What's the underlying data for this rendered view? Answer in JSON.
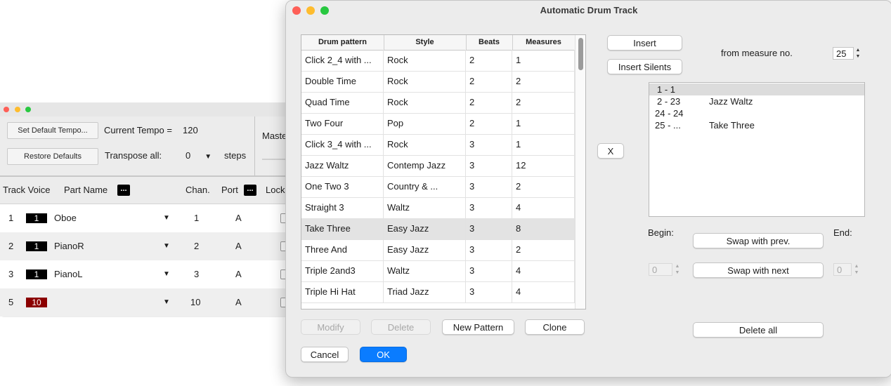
{
  "background_window": {
    "set_default_tempo_label": "Set Default Tempo...",
    "current_tempo_label": "Current Tempo =",
    "current_tempo_value": "120",
    "restore_defaults_label": "Restore Defaults",
    "transpose_label": "Transpose all:",
    "transpose_value": "0",
    "steps_label": "steps",
    "master_label": "Maste",
    "headers": {
      "track_voice": "Track Voice",
      "part_name": "Part Name",
      "ellipsis": "...",
      "chan": "Chan.",
      "port": "Port",
      "lock": "Lock"
    },
    "tracks": [
      {
        "num": "1",
        "voice": "1",
        "name": "Oboe",
        "chan": "1",
        "port": "A"
      },
      {
        "num": "2",
        "voice": "1",
        "name": "PianoR",
        "chan": "2",
        "port": "A"
      },
      {
        "num": "3",
        "voice": "1",
        "name": "PianoL",
        "chan": "3",
        "port": "A"
      },
      {
        "num": "5",
        "voice": "10",
        "name": "",
        "chan": "10",
        "port": "A"
      }
    ],
    "colors": {
      "voice_default": "#000000",
      "voice_drum": "#8b0000"
    }
  },
  "dialog": {
    "title": "Automatic Drum Track",
    "table_headers": {
      "pattern": "Drum pattern",
      "style": "Style",
      "beats": "Beats",
      "measures": "Measures"
    },
    "patterns": [
      {
        "pattern": "Click 2_4 with ...",
        "style": "Rock",
        "beats": "2",
        "measures": "1"
      },
      {
        "pattern": "Double Time",
        "style": "Rock",
        "beats": "2",
        "measures": "2"
      },
      {
        "pattern": "Quad Time",
        "style": "Rock",
        "beats": "2",
        "measures": "2"
      },
      {
        "pattern": "Two Four",
        "style": "Pop",
        "beats": "2",
        "measures": "1"
      },
      {
        "pattern": "Click 3_4 with ...",
        "style": "Rock",
        "beats": "3",
        "measures": "1"
      },
      {
        "pattern": "Jazz Waltz",
        "style": "Contemp Jazz",
        "beats": "3",
        "measures": "12"
      },
      {
        "pattern": "One Two 3",
        "style": "Country & ...",
        "beats": "3",
        "measures": "2"
      },
      {
        "pattern": "Straight 3",
        "style": "Waltz",
        "beats": "3",
        "measures": "4"
      },
      {
        "pattern": "Take Three",
        "style": "Easy Jazz",
        "beats": "3",
        "measures": "8"
      },
      {
        "pattern": "Three And",
        "style": "Easy Jazz",
        "beats": "3",
        "measures": "2"
      },
      {
        "pattern": "Triple 2and3",
        "style": "Waltz",
        "beats": "3",
        "measures": "4"
      },
      {
        "pattern": "Triple Hi Hat",
        "style": "Triad Jazz",
        "beats": "3",
        "measures": "4"
      }
    ],
    "selected_pattern": "Take Three",
    "buttons": {
      "modify": "Modify",
      "delete": "Delete",
      "new_pattern": "New Pattern",
      "clone": "Clone",
      "cancel": "Cancel",
      "ok": "OK",
      "insert": "Insert",
      "insert_silents": "Insert Silents",
      "x": "X",
      "swap_prev": "Swap with prev.",
      "swap_next": "Swap with next",
      "delete_all": "Delete all"
    },
    "from_measure_label": "from measure no.",
    "from_measure_value": "25",
    "measure_assignments": [
      {
        "range": "1 - 1",
        "pattern": ""
      },
      {
        "range": "2 - 23",
        "pattern": "Jazz Waltz"
      },
      {
        "range": "24 - 24",
        "pattern": ""
      },
      {
        "range": "25 - ...",
        "pattern": "Take Three"
      }
    ],
    "begin_label": "Begin:",
    "begin_value": "0",
    "end_label": "End:",
    "end_value": "0",
    "colors": {
      "ok_button": "#0a7cff",
      "selected_row": "#e3e3e3"
    }
  }
}
